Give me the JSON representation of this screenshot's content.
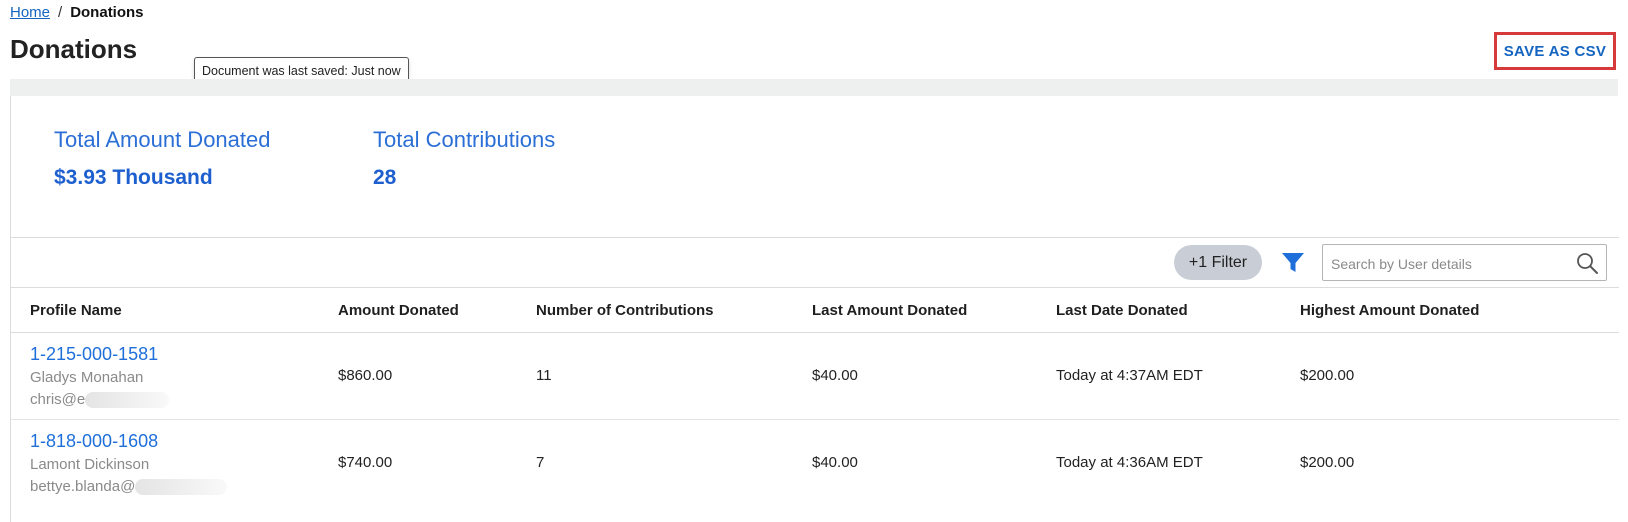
{
  "breadcrumb": {
    "home": "Home",
    "separator": "/",
    "current": "Donations"
  },
  "page_title": "Donations",
  "tooltip": "Document was last saved: Just now",
  "actions": {
    "save_csv": "SAVE AS CSV"
  },
  "colors": {
    "accent": "#1e6fd9",
    "highlight_border": "#d63a3a",
    "pill_bg": "#c9ced6"
  },
  "stats": [
    {
      "label": "Total Amount Donated",
      "value": "$3.93 Thousand"
    },
    {
      "label": "Total Contributions",
      "value": "28"
    }
  ],
  "toolbar": {
    "filter_label": "+1 Filter",
    "filter_icon": "funnel-icon",
    "search_placeholder": "Search by User details",
    "search_value": "",
    "search_icon": "search-icon"
  },
  "table": {
    "columns": [
      "Profile Name",
      "Amount Donated",
      "Number of Contributions",
      "Last Amount Donated",
      "Last Date Donated",
      "Highest Amount Donated"
    ],
    "rows": [
      {
        "phone": "1-215-000-1581",
        "name": "Gladys Monahan",
        "email_visible": "chris@e",
        "amount": "$860.00",
        "contributions": "11",
        "last_amount": "$40.00",
        "last_date": "Today at 4:37AM EDT",
        "highest": "$200.00"
      },
      {
        "phone": "1-818-000-1608",
        "name": "Lamont Dickinson",
        "email_visible": "bettye.blanda@",
        "amount": "$740.00",
        "contributions": "7",
        "last_amount": "$40.00",
        "last_date": "Today at 4:36AM EDT",
        "highest": "$200.00"
      }
    ]
  }
}
